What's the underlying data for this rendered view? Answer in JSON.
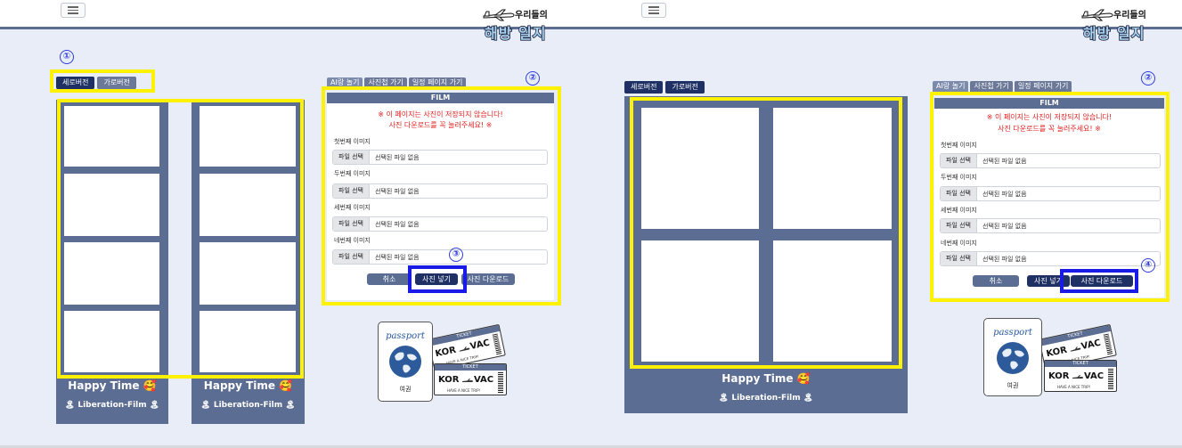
{
  "logo": {
    "small": "우리들의",
    "big": "해방 일지"
  },
  "version_buttons": {
    "vertical": "세로버전",
    "horizontal": "가로버전"
  },
  "tabs": {
    "ai": "AI랑 놀기",
    "album": "사진첩 가기",
    "schedule": "일정 페이지 가기"
  },
  "film": {
    "header": "FILM",
    "warning_line1": "※ 이 페이지는 사진이 저장되지 않습니다!",
    "warning_line2": "사진 다운로드를 꼭 눌러주세요! ※",
    "images": [
      {
        "label": "첫번째 이미지",
        "button": "파일 선택",
        "value": "선택된 파일 없음"
      },
      {
        "label": "두번째 이미지",
        "button": "파일 선택",
        "value": "선택된 파일 없음"
      },
      {
        "label": "세번째 이미지",
        "button": "파일 선택",
        "value": "선택된 파일 없음"
      },
      {
        "label": "네번째 이미지",
        "button": "파일 선택",
        "value": "선택된 파일 없음"
      }
    ],
    "cancel": "취소",
    "insert": "사진 넣기",
    "download": "사진 다운로드"
  },
  "strip": {
    "caption": "Happy Time 🥰",
    "brand": "🏝 Liberation-Film 🏝"
  },
  "deco": {
    "passport_title": "passport",
    "passport_label": "여권",
    "ticket_head": "TICKET",
    "from": "KOR",
    "to": "VAC",
    "ticket_note": "HAVE A NICE TRIP!"
  },
  "annotations": {
    "n1": "①",
    "n2": "②",
    "n3": "③",
    "n4": "④"
  },
  "colors": {
    "strip": "#5b6d92",
    "dark_button": "#1f3164",
    "highlight": "#fff200",
    "annotation_blue": "#2f3ddb",
    "warning": "#e02020"
  }
}
